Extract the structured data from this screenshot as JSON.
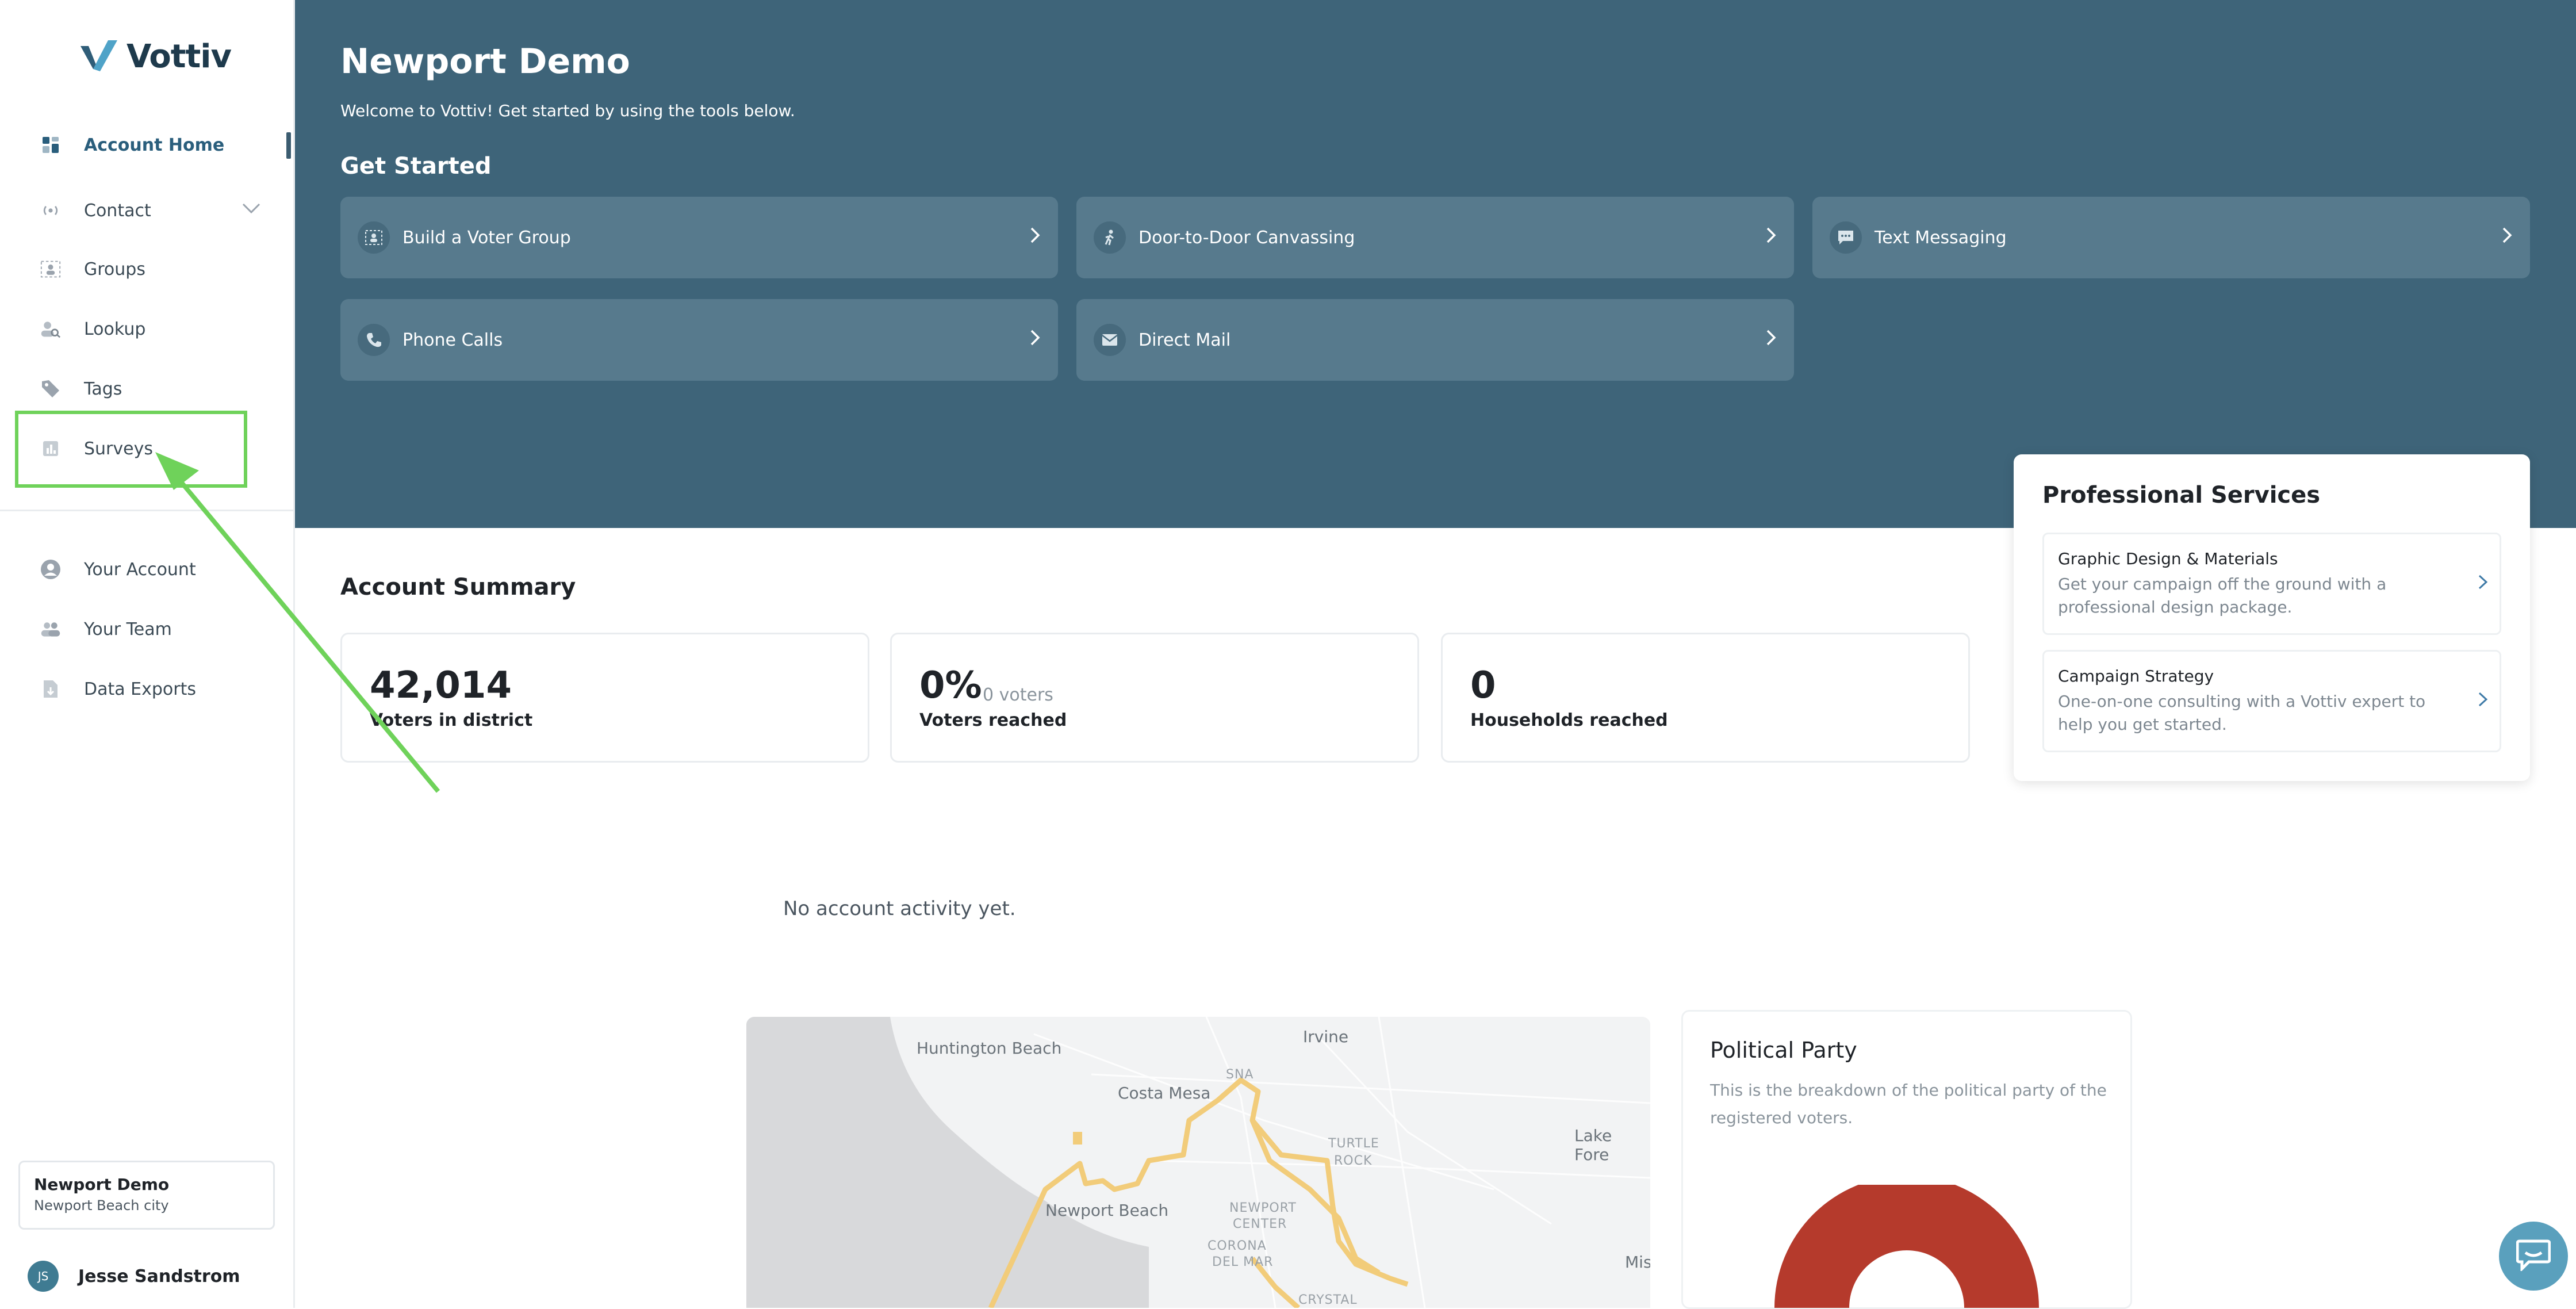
{
  "app": {
    "brand": "Vottiv"
  },
  "sidebar": {
    "items": [
      {
        "label": "Account Home",
        "icon": "dashboard-icon"
      },
      {
        "label": "Contact",
        "icon": "broadcast-icon"
      },
      {
        "label": "Groups",
        "icon": "groups-icon"
      },
      {
        "label": "Lookup",
        "icon": "user-search-icon"
      },
      {
        "label": "Tags",
        "icon": "tag-icon"
      },
      {
        "label": "Surveys",
        "icon": "survey-icon"
      },
      {
        "label": "Your Account",
        "icon": "account-circle-icon"
      },
      {
        "label": "Your Team",
        "icon": "team-icon"
      },
      {
        "label": "Data Exports",
        "icon": "file-export-icon"
      }
    ],
    "account": {
      "name": "Newport Demo",
      "location": "Newport Beach city"
    },
    "user": {
      "initials": "JS",
      "name": "Jesse Sandstrom"
    }
  },
  "header": {
    "title": "Newport Demo",
    "welcome": "Welcome to Vottiv! Get started by using the tools below.",
    "get_started": "Get Started",
    "tiles": [
      {
        "label": "Build a Voter Group",
        "icon": "voter-group-icon"
      },
      {
        "label": "Door-to-Door Canvassing",
        "icon": "walking-icon"
      },
      {
        "label": "Text Messaging",
        "icon": "sms-icon"
      },
      {
        "label": "Phone Calls",
        "icon": "phone-icon"
      },
      {
        "label": "Direct Mail",
        "icon": "mail-icon"
      }
    ]
  },
  "professional_services": {
    "title": "Professional Services",
    "items": [
      {
        "title": "Graphic Design & Materials",
        "desc": "Get your campaign off the ground with a professional design package."
      },
      {
        "title": "Campaign Strategy",
        "desc": "One-on-one consulting with a Vottiv expert to help you get started."
      }
    ]
  },
  "summary": {
    "title": "Account Summary",
    "stats": [
      {
        "value": "42,014",
        "sub": "",
        "label": "Voters in district"
      },
      {
        "value": "0%",
        "sub": "0 voters",
        "label": "Voters reached"
      },
      {
        "value": "0",
        "sub": "",
        "label": "Households reached"
      }
    ]
  },
  "activity": {
    "empty": "No account activity yet."
  },
  "map": {
    "labels": {
      "huntington": "Huntington Beach",
      "irvine": "Irvine",
      "costa_mesa": "Costa Mesa",
      "sna": "SNA",
      "turtle": "TURTLE",
      "rock": "ROCK",
      "lake_forest": "Lake Fore",
      "newport_beach": "Newport Beach",
      "newport": "NEWPORT",
      "center": "CENTER",
      "corona": "CORONA",
      "del_mar": "DEL MAR",
      "crystal": "CRYSTAL",
      "mis": "Mis"
    }
  },
  "party": {
    "title": "Political Party",
    "desc": "This is the breakdown of the political party of the registered voters."
  },
  "colors": {
    "header_bg": "#3e6479",
    "tile_bg": "#577a8d",
    "accent": "#2a5e7c",
    "highlight": "#6fd25a",
    "district_outline": "#f2cc7a",
    "donut": "#b53a2c"
  }
}
